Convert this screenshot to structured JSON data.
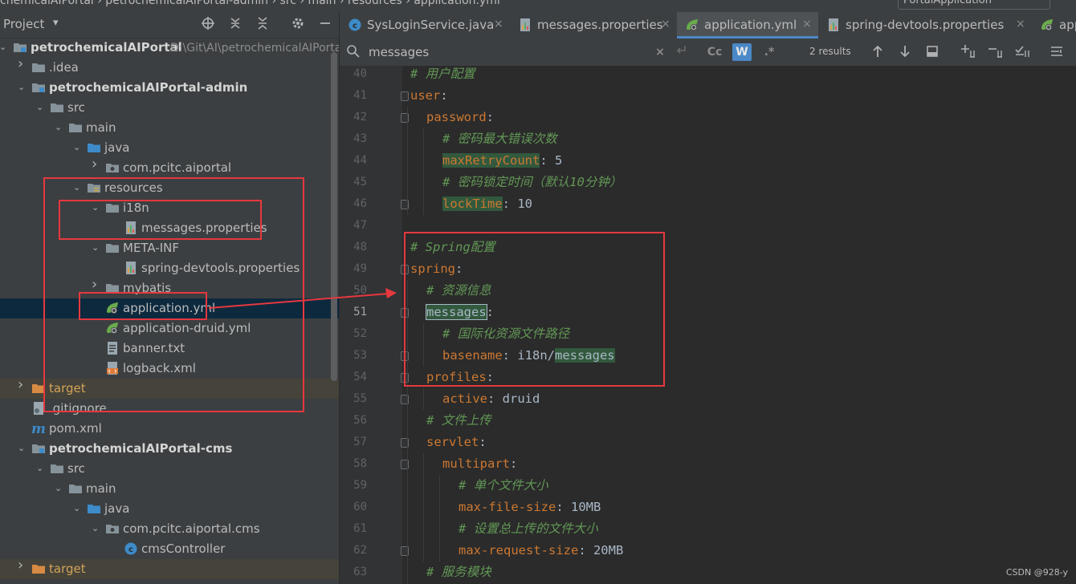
{
  "top": {
    "crumb": "chemicalAIPortal  ›  petrochemicalAIPortal-admin  ›  src  ›  main  ›  resources  ›  application.yml",
    "run_config": "PortalApplication"
  },
  "project_panel": {
    "title": "Project",
    "caret": "▾",
    "tree": [
      {
        "label": "petrochemicalAIPortal",
        "path": "D:\\Git\\AI\\petrochemicalAIPorta",
        "depth": 0,
        "arrow": "⌄",
        "icon": "module-icon",
        "bold": true
      },
      {
        "label": ".idea",
        "depth": 1,
        "arrow": "›",
        "icon": "folder-icon"
      },
      {
        "label": "petrochemicalAIPortal-admin",
        "depth": 1,
        "arrow": "⌄",
        "icon": "module-icon",
        "bold": true
      },
      {
        "label": "src",
        "depth": 2,
        "arrow": "⌄",
        "icon": "folder-icon"
      },
      {
        "label": "main",
        "depth": 3,
        "arrow": "⌄",
        "icon": "folder-icon"
      },
      {
        "label": "java",
        "depth": 4,
        "arrow": "⌄",
        "icon": "source-folder-icon"
      },
      {
        "label": "com.pcitc.aiportal",
        "depth": 5,
        "arrow": "›",
        "icon": "package-icon"
      },
      {
        "label": "resources",
        "depth": 4,
        "arrow": "⌄",
        "icon": "resources-folder-icon"
      },
      {
        "label": "i18n",
        "depth": 5,
        "arrow": "⌄",
        "icon": "folder-icon"
      },
      {
        "label": "messages.properties",
        "depth": 6,
        "arrow": "",
        "icon": "properties-file-icon"
      },
      {
        "label": "META-INF",
        "depth": 5,
        "arrow": "⌄",
        "icon": "folder-icon"
      },
      {
        "label": "spring-devtools.properties",
        "depth": 6,
        "arrow": "",
        "icon": "properties-file-icon"
      },
      {
        "label": "mybatis",
        "depth": 5,
        "arrow": "›",
        "icon": "folder-icon"
      },
      {
        "label": "application.yml",
        "depth": 5,
        "arrow": "",
        "icon": "spring-yml-icon",
        "selected": true
      },
      {
        "label": "application-druid.yml",
        "depth": 5,
        "arrow": "",
        "icon": "spring-yml-icon"
      },
      {
        "label": "banner.txt",
        "depth": 5,
        "arrow": "",
        "icon": "text-file-icon"
      },
      {
        "label": "logback.xml",
        "depth": 5,
        "arrow": "",
        "icon": "xml-file-icon"
      },
      {
        "label": "target",
        "depth": 1,
        "arrow": "›",
        "icon": "excluded-folder-icon",
        "excluded": true
      },
      {
        "label": ".gitignore",
        "depth": 1,
        "arrow": "",
        "icon": "gitignore-icon"
      },
      {
        "label": "pom.xml",
        "depth": 1,
        "arrow": "",
        "icon": "maven-icon"
      },
      {
        "label": "petrochemicalAIPortal-cms",
        "depth": 1,
        "arrow": "⌄",
        "icon": "module-icon",
        "bold": true
      },
      {
        "label": "src",
        "depth": 2,
        "arrow": "⌄",
        "icon": "folder-icon"
      },
      {
        "label": "main",
        "depth": 3,
        "arrow": "⌄",
        "icon": "folder-icon"
      },
      {
        "label": "java",
        "depth": 4,
        "arrow": "⌄",
        "icon": "source-folder-icon"
      },
      {
        "label": "com.pcitc.aiportal.cms",
        "depth": 5,
        "arrow": "⌄",
        "icon": "package-icon"
      },
      {
        "label": "cmsController",
        "depth": 6,
        "arrow": "",
        "icon": "class-icon"
      },
      {
        "label": "target",
        "depth": 1,
        "arrow": "›",
        "icon": "excluded-folder-icon",
        "excluded": true
      }
    ]
  },
  "tabs": [
    {
      "label": "SysLoginService.java",
      "icon": "class-icon",
      "close": "×"
    },
    {
      "label": "messages.properties",
      "icon": "properties-file-icon",
      "close": "×"
    },
    {
      "label": "application.yml",
      "icon": "spring-yml-icon",
      "close": "×",
      "active": true
    },
    {
      "label": "spring-devtools.properties",
      "icon": "properties-file-icon",
      "close": "×"
    },
    {
      "label": "app",
      "icon": "spring-yml-icon",
      "close": ""
    }
  ],
  "search": {
    "query": "messages",
    "clear": "×",
    "match_case": "Cc",
    "words": "W",
    "regex": ".*",
    "results": "2 results"
  },
  "editor": {
    "current_line": "51",
    "lines": [
      {
        "num": "40",
        "indent": 0,
        "parts": [
          {
            "t": "# 用户配置",
            "c": "c"
          }
        ]
      },
      {
        "num": "41",
        "indent": 0,
        "fold": true,
        "parts": [
          {
            "t": "user",
            "c": "k"
          },
          {
            "t": ":",
            "c": "v"
          }
        ]
      },
      {
        "num": "42",
        "indent": 1,
        "fold": true,
        "parts": [
          {
            "t": "password",
            "c": "k"
          },
          {
            "t": ":",
            "c": "v"
          }
        ]
      },
      {
        "num": "43",
        "indent": 2,
        "parts": [
          {
            "t": "# 密码最大错误次数",
            "c": "c"
          }
        ]
      },
      {
        "num": "44",
        "indent": 2,
        "parts": [
          {
            "t": "maxRetryCount",
            "c": "hl"
          },
          {
            "t": ": 5",
            "c": "v"
          }
        ]
      },
      {
        "num": "45",
        "indent": 2,
        "parts": [
          {
            "t": "# 密码锁定时间（默认10分钟）",
            "c": "c"
          }
        ]
      },
      {
        "num": "46",
        "indent": 2,
        "fold": true,
        "parts": [
          {
            "t": "lockTime",
            "c": "hl"
          },
          {
            "t": ": 10",
            "c": "v"
          }
        ]
      },
      {
        "num": "47",
        "indent": 0,
        "parts": []
      },
      {
        "num": "48",
        "indent": 0,
        "parts": [
          {
            "t": "# Spring配置",
            "c": "c"
          }
        ]
      },
      {
        "num": "49",
        "indent": 0,
        "fold": true,
        "parts": [
          {
            "t": "spring",
            "c": "k"
          },
          {
            "t": ":",
            "c": "v"
          }
        ]
      },
      {
        "num": "50",
        "indent": 1,
        "parts": [
          {
            "t": "# 资源信息",
            "c": "c"
          }
        ]
      },
      {
        "num": "51",
        "indent": 1,
        "fold": true,
        "parts": [
          {
            "t": "messages",
            "c": "hl-box"
          },
          {
            "t": ":",
            "c": "v"
          }
        ]
      },
      {
        "num": "52",
        "indent": 2,
        "parts": [
          {
            "t": "# 国际化资源文件路径",
            "c": "c"
          }
        ]
      },
      {
        "num": "53",
        "indent": 2,
        "fold": true,
        "parts": [
          {
            "t": "basename",
            "c": "k"
          },
          {
            "t": ": i18n/",
            "c": "v"
          },
          {
            "t": "messages",
            "c": "hlv"
          }
        ]
      },
      {
        "num": "54",
        "indent": 1,
        "fold": true,
        "parts": [
          {
            "t": "profiles",
            "c": "k"
          },
          {
            "t": ":",
            "c": "v"
          }
        ]
      },
      {
        "num": "55",
        "indent": 2,
        "fold": true,
        "parts": [
          {
            "t": "active",
            "c": "k"
          },
          {
            "t": ": druid",
            "c": "v"
          }
        ]
      },
      {
        "num": "56",
        "indent": 1,
        "parts": [
          {
            "t": "# 文件上传",
            "c": "c"
          }
        ]
      },
      {
        "num": "57",
        "indent": 1,
        "fold": true,
        "parts": [
          {
            "t": "servlet",
            "c": "k"
          },
          {
            "t": ":",
            "c": "v"
          }
        ]
      },
      {
        "num": "58",
        "indent": 2,
        "fold": true,
        "parts": [
          {
            "t": "multipart",
            "c": "k"
          },
          {
            "t": ":",
            "c": "v"
          }
        ]
      },
      {
        "num": "59",
        "indent": 3,
        "parts": [
          {
            "t": "# 单个文件大小",
            "c": "c"
          }
        ]
      },
      {
        "num": "60",
        "indent": 3,
        "parts": [
          {
            "t": "max-file-size",
            "c": "k"
          },
          {
            "t": ": 10MB",
            "c": "v"
          }
        ]
      },
      {
        "num": "61",
        "indent": 3,
        "parts": [
          {
            "t": "# 设置总上传的文件大小",
            "c": "c"
          }
        ]
      },
      {
        "num": "62",
        "indent": 3,
        "fold": true,
        "parts": [
          {
            "t": "max-request-size",
            "c": "k"
          },
          {
            "t": ": 20MB",
            "c": "v"
          }
        ]
      },
      {
        "num": "63",
        "indent": 1,
        "parts": [
          {
            "t": "# 服务模块",
            "c": "c"
          }
        ]
      }
    ]
  },
  "watermark": "CSDN @928-y",
  "colors": {
    "annotation_red": "#e6383f",
    "selection_blue": "#0d293e",
    "match_green": "#32593d",
    "keyword_orange": "#cc7832",
    "comment_green": "#629755"
  }
}
